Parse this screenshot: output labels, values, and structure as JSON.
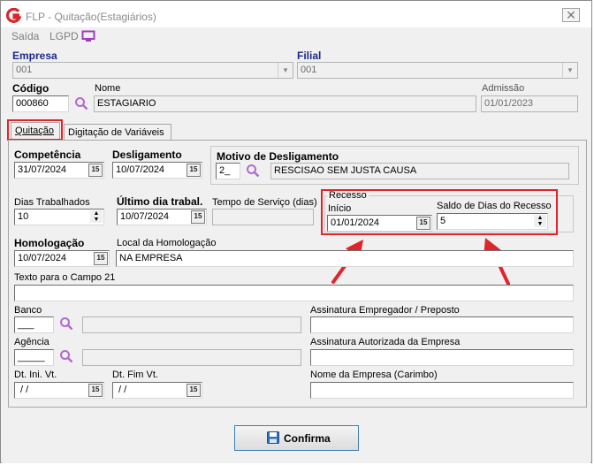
{
  "window": {
    "title": "FLP - Quitação(Estagiários)",
    "close_glyph": "✕"
  },
  "menu": {
    "items": [
      "Saída",
      "LGPD"
    ]
  },
  "header": {
    "empresa_label": "Empresa",
    "empresa_value": "001",
    "filial_label": "Filial",
    "filial_value": "001",
    "codigo_label": "Código",
    "codigo_value": "000860",
    "nome_label": "Nome",
    "nome_value": "ESTAGIARIO",
    "admissao_label": "Admissão",
    "admissao_value": "01/01/2023"
  },
  "tabs": [
    {
      "label": "Quitação",
      "active": true
    },
    {
      "label": "Digitação de Variáveis",
      "active": false
    }
  ],
  "form": {
    "competencia_label": "Competência",
    "competencia_value": "31/07/2024",
    "desligamento_label": "Desligamento",
    "desligamento_value": "10/07/2024",
    "motivo_label": "Motivo de Desligamento",
    "motivo_code": "2_",
    "motivo_desc": "RESCISAO SEM JUSTA CAUSA",
    "dias_trab_label": "Dias Trabalhados",
    "dias_trab_value": "10",
    "ultimo_dia_label": "Último dia trabal.",
    "ultimo_dia_value": "10/07/2024",
    "tempo_servico_label": "Tempo de Serviço (dias)",
    "tempo_servico_value": "",
    "recesso_label": "Recesso",
    "inicio_label": "Início",
    "inicio_value": "01/01/2024",
    "saldo_label": "Saldo de Dias do Recesso",
    "saldo_value": "5",
    "homologacao_label": "Homologação",
    "homologacao_value": "10/07/2024",
    "local_homologacao_label": "Local da Homologação",
    "local_homologacao_value": "NA EMPRESA",
    "texto_campo21_label": "Texto para o Campo 21",
    "texto_campo21_value": "",
    "banco_label": "Banco",
    "banco_value": "___",
    "agencia_label": "Agência",
    "agencia_value": "_____",
    "ass_empregador_label": "Assinatura Empregador / Preposto",
    "ass_autorizada_label": "Assinatura Autorizada da Empresa",
    "dt_ini_vt_label": "Dt. Ini. Vt.",
    "dt_ini_vt_value": " / /",
    "dt_fim_vt_label": "Dt. Fim Vt.",
    "dt_fim_vt_value": " / /",
    "nome_empresa_label": "Nome da Empresa (Carimbo)"
  },
  "confirm_button": {
    "label": "Confirma"
  },
  "calendar_glyph": "15",
  "icons": {
    "search": "search-icon",
    "calendar": "calendar-icon",
    "monitor": "monitor-icon",
    "save": "floppy-icon"
  },
  "colors": {
    "accent_red": "#e0242b",
    "label_blue": "#1b2a8a",
    "search_icon": "#b06ad0",
    "monitor_icon": "#a03ac0"
  }
}
